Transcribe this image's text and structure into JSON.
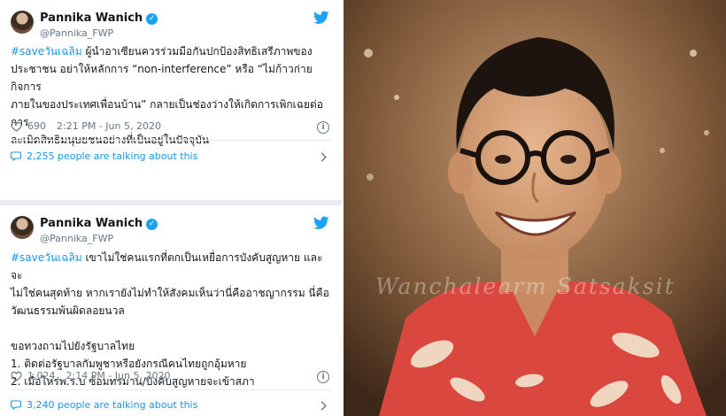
{
  "tweets": [
    {
      "author": "Pannika Wanich",
      "handle": "@Pannika_FWP",
      "hashtag": "#saveวันเฉลิม",
      "lines": [
        " ผู้นำอาเซียนควรร่วมมือกันปกป้องสิทธิเสรีภาพของ",
        "ประชาชน อย่าให้หลักการ “non-interference” หรือ “ไม่ก้าวก่ายกิจการ",
        "ภายในของประเทศเพื่อนบ้าน” กลายเป็นช่องว่างให้เกิดการเพิกเฉยต่อการ",
        "ละเมิดสิทธิมนุษยชนอย่างที่เป็นอยู่ในปัจจุบัน"
      ],
      "likes": "690",
      "time": "2:21 PM - Jun 5, 2020",
      "talking": "2,255 people are talking about this"
    },
    {
      "author": "Pannika Wanich",
      "handle": "@Pannika_FWP",
      "hashtag": "#saveวันเฉลิม",
      "lines": [
        " เขาไม่ใช่คนแรกที่ตกเป็นเหยื่อการบังคับสูญหาย และจะ",
        "ไม่ใช่คนสุดท้าย หากเรายังไม่ทำให้สังคมเห็นว่านี่คืออาชญากรรม นี่คือ",
        "วัฒนธรรมพ้นผิดลอยนวล",
        "",
        "ขอทวงถามไปยังรัฐบาลไทย",
        "1. ติดต่อรัฐบาลกัมพูชาหรือยังกรณีคนไทยถูกอุ้มหาย",
        "2. เมื่อไหร่พ.ร.บ ซ้อมทรมาน/บังคับสูญหายจะเข้าสภา"
      ],
      "likes": "1,024",
      "time": "2:14 PM - Jun 5, 2020",
      "talking": "3,240 people are talking about this"
    }
  ],
  "photo": {
    "watermark": "Wanchalearm Satsaksit"
  },
  "colors": {
    "twitter_blue": "#1da1f2",
    "link_blue": "#1b95e0",
    "muted": "#657786",
    "shirt_red": "#d9473e"
  },
  "icons": [
    "verified-badge-icon",
    "twitter-bird-icon",
    "heart-icon",
    "info-icon",
    "chat-bubble-icon",
    "chevron-right-icon"
  ]
}
